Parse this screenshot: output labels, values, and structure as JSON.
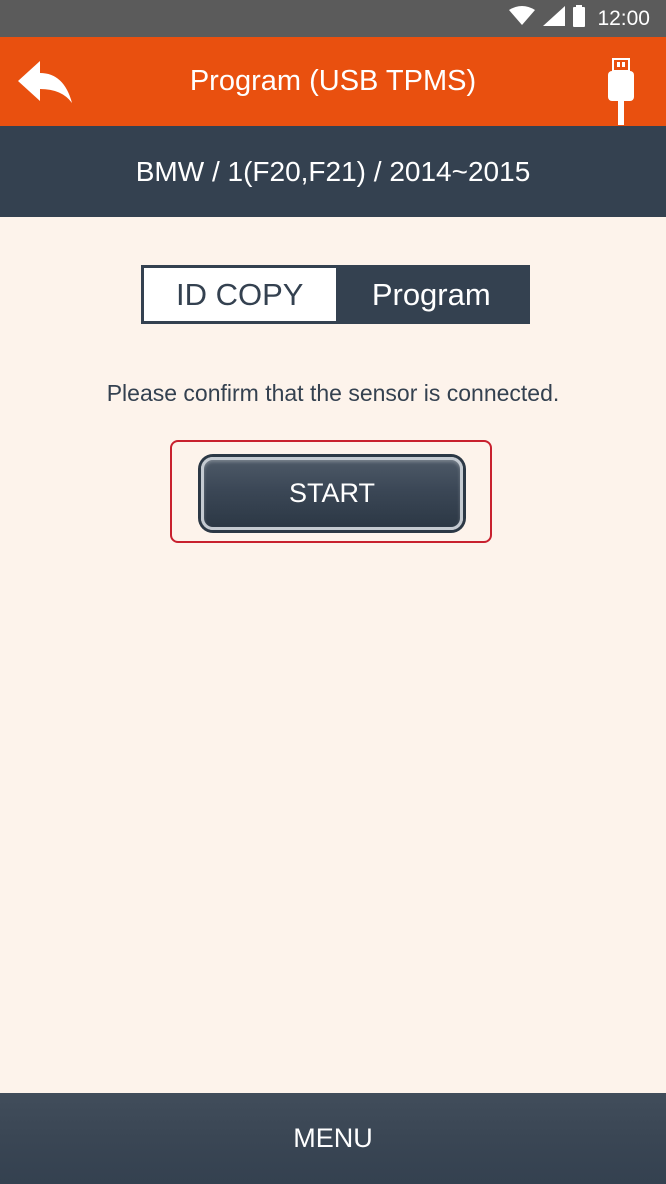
{
  "status_bar": {
    "time": "12:00",
    "icons": [
      "wifi-icon",
      "signal-icon",
      "battery-icon"
    ]
  },
  "app_bar": {
    "title": "Program (USB TPMS)",
    "back_icon": "back-arrow-icon",
    "usb_icon": "usb-plug-icon"
  },
  "vehicle": {
    "path": "BMW / 1(F20,F21) / 2014~2015"
  },
  "mode_toggle": {
    "options": [
      {
        "label": "ID COPY",
        "selected": false
      },
      {
        "label": "Program",
        "selected": true
      }
    ]
  },
  "main": {
    "message": "Please confirm that the sensor is connected.",
    "start_label": "START"
  },
  "bottom_bar": {
    "menu_label": "MENU"
  },
  "colors": {
    "accent": "#e9500f",
    "dark": "#344150",
    "background": "#fdf3eb",
    "highlight": "#c8202e"
  }
}
